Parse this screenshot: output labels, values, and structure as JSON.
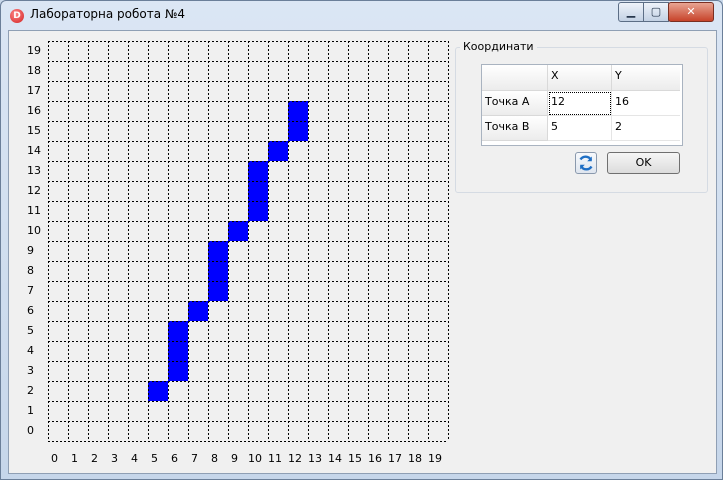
{
  "window": {
    "title": "Лабораторна робота №4",
    "app_icon_letter": "D",
    "controls": {
      "minimize": "▁",
      "maximize": "▢",
      "close": "✕"
    }
  },
  "grid": {
    "x_labels": [
      "0",
      "1",
      "2",
      "3",
      "4",
      "5",
      "6",
      "7",
      "8",
      "9",
      "10",
      "11",
      "12",
      "13",
      "14",
      "15",
      "16",
      "17",
      "18",
      "19"
    ],
    "y_labels": [
      "0",
      "1",
      "2",
      "3",
      "4",
      "5",
      "6",
      "7",
      "8",
      "9",
      "10",
      "11",
      "12",
      "13",
      "14",
      "15",
      "16",
      "17",
      "18",
      "19"
    ],
    "fill_color": "#0000ff",
    "filled_cells": [
      [
        5,
        2
      ],
      [
        6,
        3
      ],
      [
        6,
        4
      ],
      [
        6,
        5
      ],
      [
        7,
        6
      ],
      [
        8,
        7
      ],
      [
        8,
        8
      ],
      [
        8,
        9
      ],
      [
        9,
        10
      ],
      [
        10,
        11
      ],
      [
        10,
        12
      ],
      [
        10,
        13
      ],
      [
        11,
        14
      ],
      [
        12,
        15
      ],
      [
        12,
        16
      ]
    ]
  },
  "coords": {
    "group_title": "Координати",
    "col_headers": [
      "",
      "X",
      "Y"
    ],
    "rows": [
      {
        "label": "Точка A",
        "x": "12",
        "y": "16"
      },
      {
        "label": "Точка B",
        "x": "5",
        "y": "2"
      }
    ]
  },
  "buttons": {
    "refresh_icon": "refresh-icon",
    "ok_label": "OK"
  }
}
